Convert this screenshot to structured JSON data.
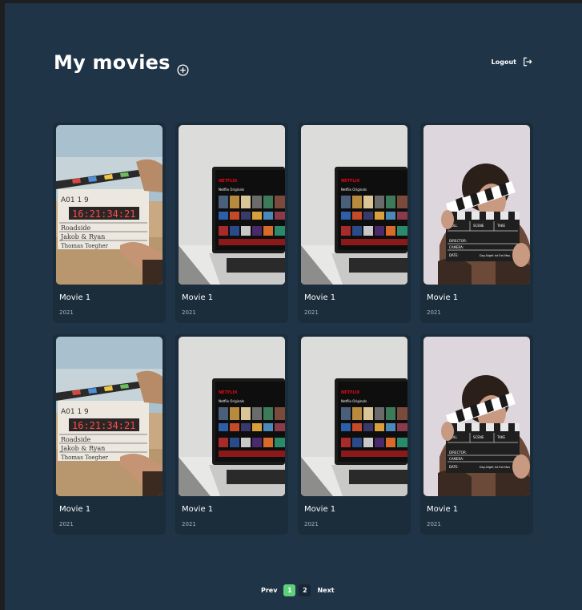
{
  "header": {
    "title": "My movies",
    "logout_label": "Logout"
  },
  "movies": [
    {
      "title": "Movie 1",
      "year": "2021",
      "image": "clapperboard-desert"
    },
    {
      "title": "Movie 1",
      "year": "2021",
      "image": "netflix-laptop"
    },
    {
      "title": "Movie 1",
      "year": "2021",
      "image": "netflix-laptop"
    },
    {
      "title": "Movie 1",
      "year": "2021",
      "image": "clapperboard-person"
    },
    {
      "title": "Movie 1",
      "year": "2021",
      "image": "clapperboard-desert"
    },
    {
      "title": "Movie 1",
      "year": "2021",
      "image": "netflix-laptop"
    },
    {
      "title": "Movie 1",
      "year": "2021",
      "image": "netflix-laptop"
    },
    {
      "title": "Movie 1",
      "year": "2021",
      "image": "clapperboard-person"
    }
  ],
  "pagination": {
    "prev_label": "Prev",
    "pages": [
      "1",
      "2"
    ],
    "current_page": "1",
    "next_label": "Next"
  },
  "colors": {
    "background": "#1f3446",
    "card": "#1b2c3b",
    "accent": "#5fd07a"
  }
}
